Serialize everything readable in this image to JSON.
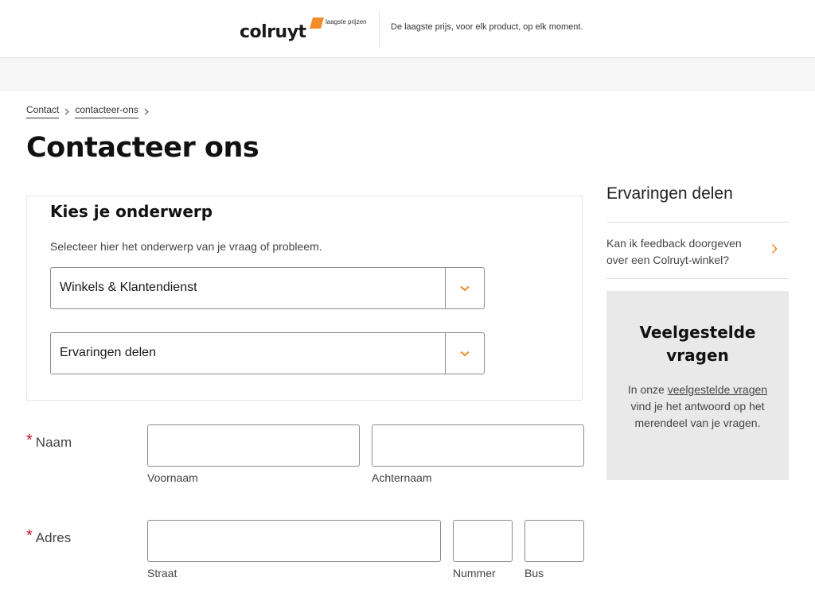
{
  "header": {
    "logo_text": "colruyt",
    "logo_tagline": "laagste prijzen",
    "slogan": "De laagste prijs, voor elk product, op elk moment."
  },
  "colors": {
    "accent": "#f28c28",
    "required": "#c8102e",
    "faq_background": "#e9e9e9"
  },
  "breadcrumb": {
    "items": [
      "Contact",
      "contacteer-ons"
    ]
  },
  "page": {
    "title": "Contacteer ons"
  },
  "topic": {
    "heading": "Kies je onderwerp",
    "description": "Selecteer hier het onderwerp van je vraag of probleem.",
    "select1_value": "Winkels & Klantendienst",
    "select2_value": "Ervaringen delen",
    "dropdown_icon": "chevron-down-icon"
  },
  "form": {
    "required_marker": "*",
    "naam": {
      "label": "Naam",
      "first_name_label": "Voornaam",
      "last_name_label": "Achternaam"
    },
    "adres": {
      "label": "Adres",
      "street_label": "Straat",
      "number_label": "Nummer",
      "bus_label": "Bus"
    }
  },
  "sidebar": {
    "title": "Ervaringen delen",
    "link_text": "Kan ik feedback doorgeven over een Colruyt-winkel?",
    "link_icon": "chevron-right-icon",
    "faq": {
      "title": "Veelgestelde vragen",
      "text_before": "In onze ",
      "link_text": "veelgestelde vragen",
      "text_after": " vind je het antwoord op het merendeel van je vragen."
    }
  }
}
